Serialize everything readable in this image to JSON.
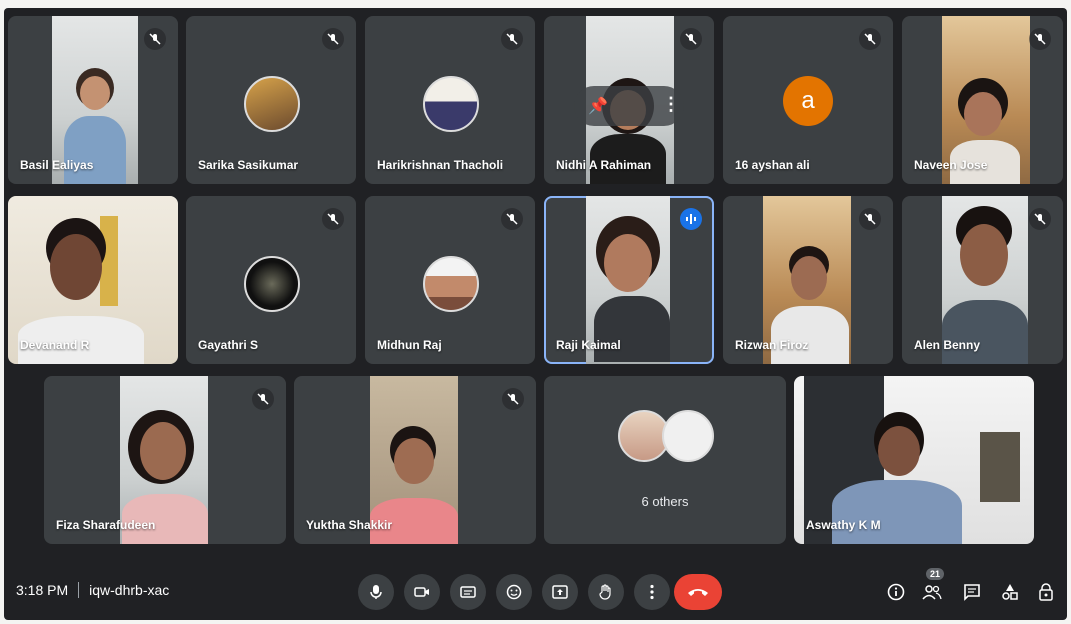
{
  "meeting": {
    "time": "3:18 PM",
    "code": "iqw-dhrb-xac"
  },
  "participants": [
    {
      "name": "Basil Ealiyas",
      "muted": true
    },
    {
      "name": "Sarika Sasikumar",
      "muted": true
    },
    {
      "name": "Harikrishnan Thacholi",
      "muted": true
    },
    {
      "name": "Nidhi A Rahiman",
      "muted": true
    },
    {
      "name": "16 ayshan ali",
      "muted": true,
      "initial": "a"
    },
    {
      "name": "Naveen Jose",
      "muted": true
    },
    {
      "name": "Devanand R",
      "muted": false
    },
    {
      "name": "Gayathri S",
      "muted": true
    },
    {
      "name": "Midhun Raj",
      "muted": true
    },
    {
      "name": "Raji Kaimal",
      "muted": false,
      "speaking": true
    },
    {
      "name": "Rizwan Firoz",
      "muted": true
    },
    {
      "name": "Alen Benny",
      "muted": true
    },
    {
      "name": "Fiza Sharafudeen",
      "muted": true
    },
    {
      "name": "Yuktha Shakkir",
      "muted": true
    },
    {
      "name": "Aswathy K M",
      "muted": false
    }
  ],
  "others_tile": {
    "label": "6 others"
  },
  "controls": {
    "participants_count": "21"
  },
  "colors": {
    "background": "#202124",
    "tile": "#3c4043",
    "end_call": "#ea4335",
    "avatar_letter": "#e37400",
    "speaking_outline": "#8ab4f8"
  }
}
